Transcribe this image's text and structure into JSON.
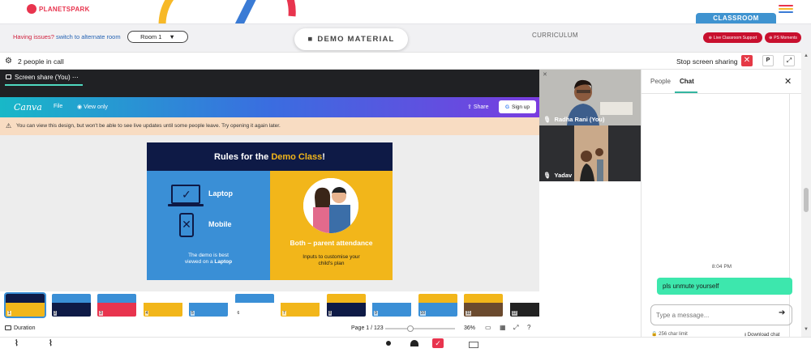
{
  "brand": {
    "name": "PLANETSPARK"
  },
  "header": {
    "issues_text": "Having issues?",
    "switch_text": "switch to alternate room",
    "room_select": "Room 1",
    "demo_material": "DEMO MATERIAL",
    "curriculum": "CURRICULUM",
    "classroom_tab": "CLASSROOM",
    "live_support": "Live Classroom Support",
    "ps_moments": "PS Moments"
  },
  "callbar": {
    "people_in_call": "2 people in call",
    "stop_sharing": "Stop screen sharing",
    "p_label": "P"
  },
  "stage": {
    "title": "Screen share (You)",
    "canva": {
      "logo": "Canva",
      "file": "File",
      "view_only": "View only",
      "share": "Share",
      "sign_up": "Sign up"
    },
    "warning": "You can view this design, but won't be able to see live updates until some people leave. Try opening it again later.",
    "slide": {
      "title_pre": "Rules for the ",
      "title_hl": "Demo Class",
      "title_post": "!",
      "laptop": "Laptop",
      "mobile": "Mobile",
      "demo_note_1": "The demo is best",
      "demo_note_2": "viewed on a ",
      "demo_note_bold": "Laptop",
      "both": "Both – parent attendance",
      "inputs_1": "Inputs to customise your",
      "inputs_2": "child's plan"
    },
    "thumbnails": [
      "1",
      "2",
      "3",
      "4",
      "5",
      "6",
      "7",
      "8",
      "9",
      "10",
      "11",
      "12"
    ],
    "footer": {
      "duration": "Duration",
      "page": "Page 1 / 123",
      "zoom": "36%",
      "zoom_fraction": 0.36
    }
  },
  "participants": [
    {
      "name": "Radha Rani (You)"
    },
    {
      "name": "Yadav"
    }
  ],
  "side": {
    "tab_people": "People",
    "tab_chat": "Chat",
    "timestamp": "8:04 PM",
    "message": "pls unmute yourself",
    "input_placeholder": "Type a message...",
    "char_limit": "256 char limit",
    "download_chat": "Download chat"
  },
  "colors": {
    "brand_red": "#e8344e",
    "accent_teal": "#3de7ad",
    "classroom_blue": "#3f93d0",
    "slide_navy": "#0e1a46",
    "slide_yellow": "#f2b61a",
    "slide_blue": "#3a8fd6"
  }
}
